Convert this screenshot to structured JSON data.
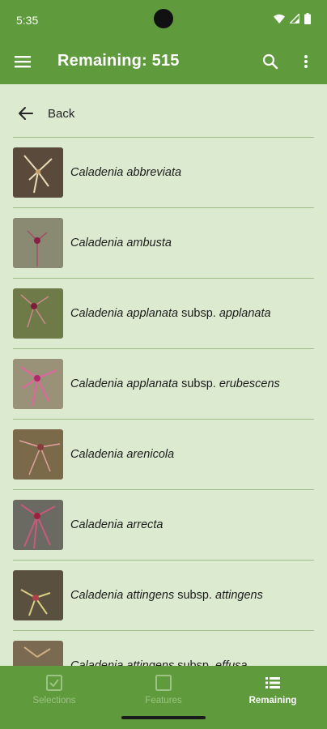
{
  "status_bar": {
    "time": "5:35"
  },
  "app_bar": {
    "title": "Remaining: 515"
  },
  "back": {
    "label": "Back"
  },
  "species": [
    {
      "genus": "Caladenia",
      "epithet": "abbreviata",
      "rank": "",
      "infra": ""
    },
    {
      "genus": "Caladenia",
      "epithet": "ambusta",
      "rank": "",
      "infra": ""
    },
    {
      "genus": "Caladenia",
      "epithet": "applanata",
      "rank": "subsp.",
      "infra": "applanata"
    },
    {
      "genus": "Caladenia",
      "epithet": "applanata",
      "rank": "subsp.",
      "infra": "erubescens"
    },
    {
      "genus": "Caladenia",
      "epithet": "arenicola",
      "rank": "",
      "infra": ""
    },
    {
      "genus": "Caladenia",
      "epithet": "arrecta",
      "rank": "",
      "infra": ""
    },
    {
      "genus": "Caladenia",
      "epithet": "attingens",
      "rank": "subsp.",
      "infra": "attingens"
    },
    {
      "genus": "Caladenia",
      "epithet": "attingens",
      "rank": "subsp.",
      "infra": "effusa"
    }
  ],
  "bottom_nav": {
    "selections": "Selections",
    "features": "Features",
    "remaining": "Remaining"
  },
  "colors": {
    "primary": "#5f9a3c",
    "background": "#dcebd0",
    "divider": "#9fbd8a",
    "nav_inactive": "#9cc383"
  }
}
